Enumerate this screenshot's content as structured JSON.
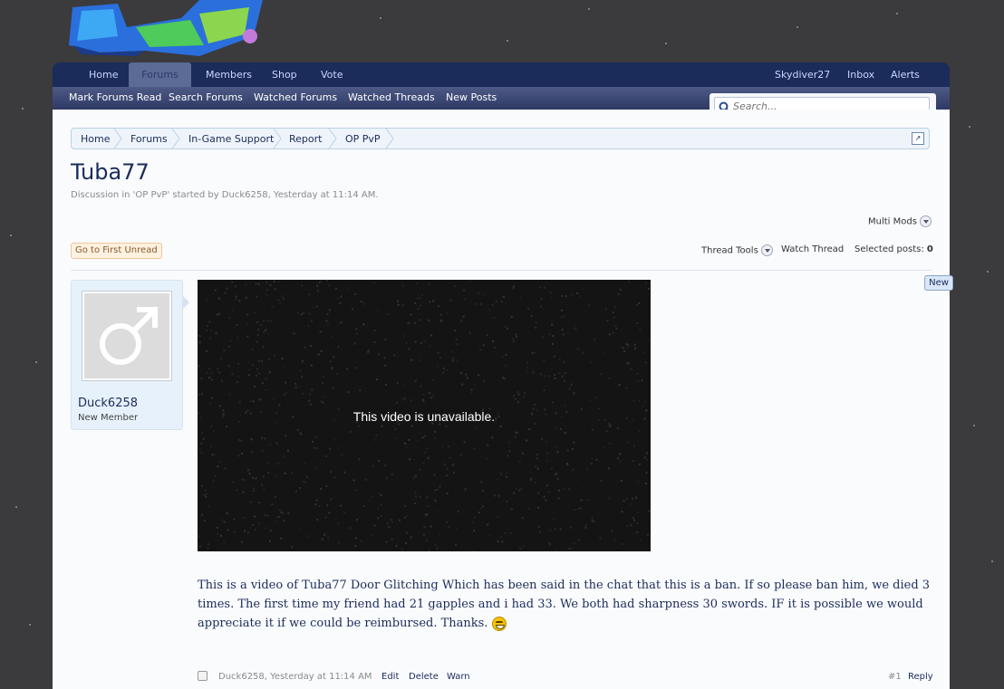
{
  "colors": {
    "page_bg": "#3b3a3c",
    "nav_bg": "#1b2c5a",
    "accent": "#1b2c5a",
    "panel_bg": "#fafbfd"
  },
  "header": {
    "logo_icon": "site-logo"
  },
  "nav": {
    "items": [
      "Home",
      "Forums",
      "Members",
      "Shop",
      "Vote"
    ],
    "active": "Forums",
    "user": "Skydiver27",
    "inbox": "Inbox",
    "alerts": "Alerts"
  },
  "subnav": {
    "items": [
      "Mark Forums Read",
      "Search Forums",
      "Watched Forums",
      "Watched Threads",
      "New Posts"
    ]
  },
  "search": {
    "placeholder": "Search..."
  },
  "breadcrumb": {
    "items": [
      "Home",
      "Forums",
      "In-Game Support",
      "Report",
      "OP PvP"
    ]
  },
  "thread": {
    "title": "Tuba77",
    "meta": "Discussion in 'OP PvP' started by Duck6258, Yesterday at 11:14 AM.",
    "multi_mods": "Multi Mods",
    "first_unread": "Go to First Unread",
    "thread_tools": "Thread Tools",
    "watch_thread": "Watch Thread",
    "selected_posts_label": "Selected posts:",
    "selected_posts_count": "0"
  },
  "post": {
    "username": "Duck6258",
    "user_title": "New Member",
    "video_message": "This video is unavailable.",
    "new_badge": "New",
    "body": "This is a video of Tuba77 Door Glitching Which has been said in the chat that this is a ban. If so please ban him, we died 3 times. The first time my friend had 21 gapples and i had 33. We both had sharpness 30 swords. IF it is possible we would appreciate it if we could be reimbursed. Thanks.",
    "footer_meta": "Duck6258, Yesterday at 11:14 AM",
    "edit": "Edit",
    "delete": "Delete",
    "warn": "Warn",
    "number": "#1",
    "reply": "Reply"
  }
}
